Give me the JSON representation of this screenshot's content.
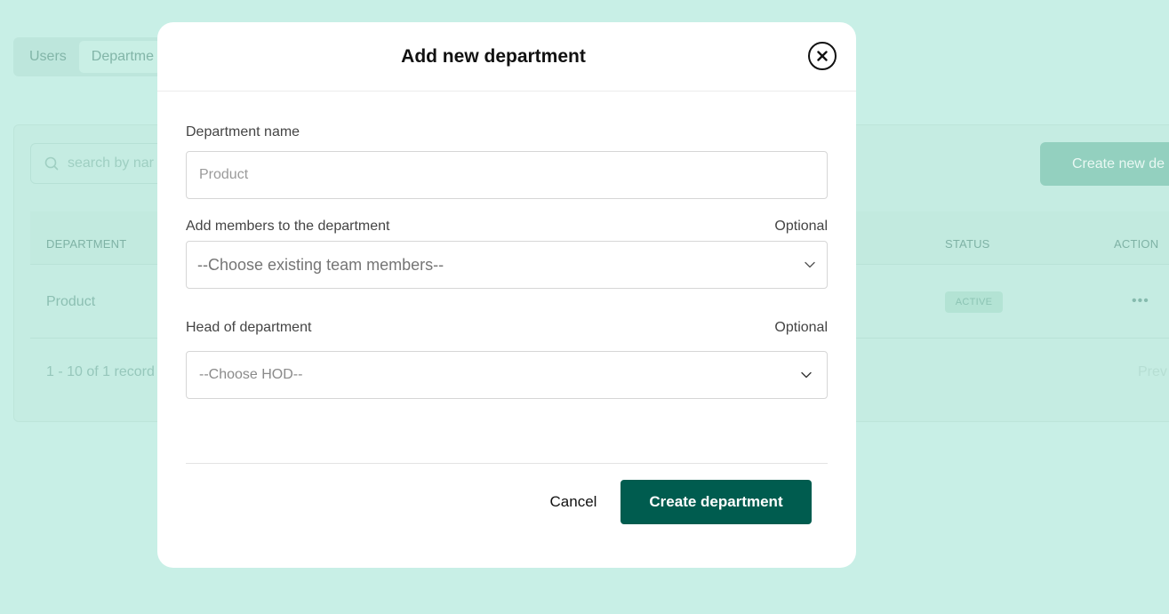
{
  "background": {
    "tabs": [
      {
        "label": "Users"
      },
      {
        "label": "Departme"
      }
    ],
    "search": {
      "placeholder": "search by nar"
    },
    "create_button": "Create new de",
    "table": {
      "headers": {
        "department": "DEPARTMENT",
        "status": "STATUS",
        "action": "ACTION"
      },
      "rows": [
        {
          "department": "Product",
          "status": "ACTIVE",
          "action": "•••"
        }
      ]
    },
    "pagination": {
      "records": "1 - 10 of 1 record",
      "prev": "Prev"
    }
  },
  "modal": {
    "title": "Add new department",
    "department_name": {
      "label": "Department name",
      "placeholder": "Product",
      "value": ""
    },
    "members": {
      "label": "Add members to the department",
      "optional": "Optional",
      "selected": "--Choose existing team members--"
    },
    "hod": {
      "label": "Head of department",
      "optional": "Optional",
      "selected": "--Choose HOD--"
    },
    "cancel_label": "Cancel",
    "submit_label": "Create department"
  },
  "colors": {
    "primary": "#005c4f",
    "backdrop": "#c8efe6"
  }
}
